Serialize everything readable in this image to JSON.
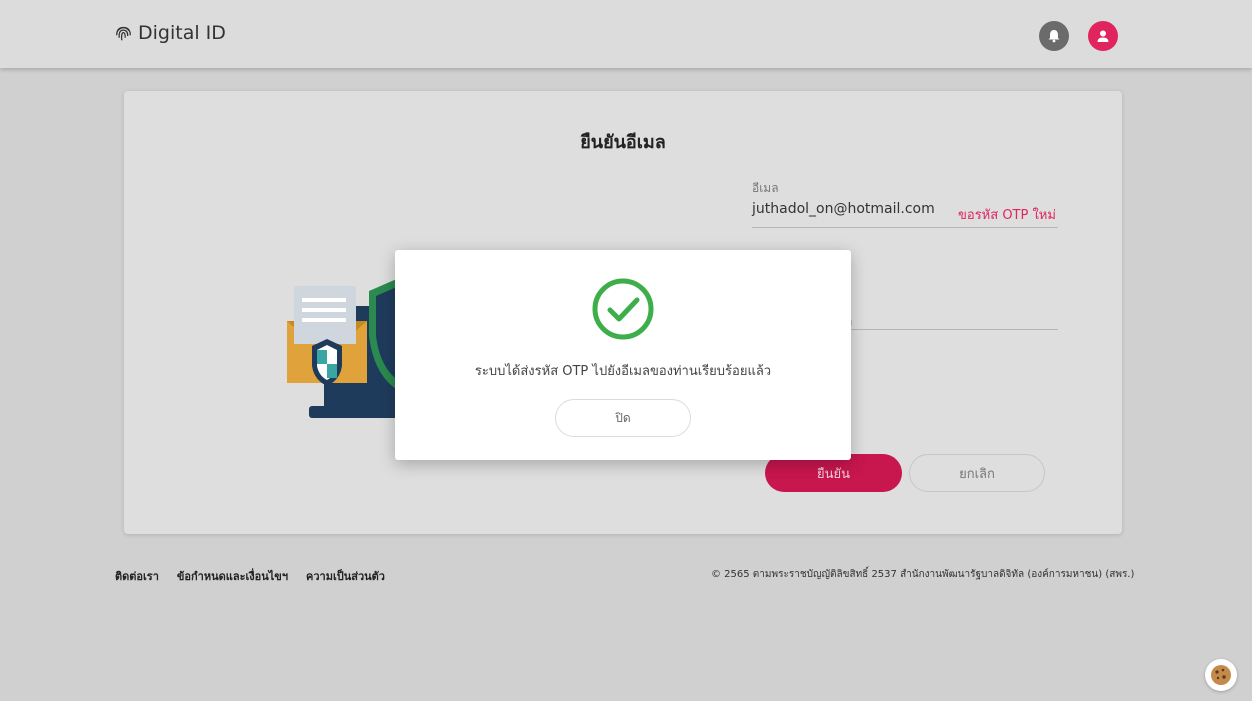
{
  "header": {
    "app_title": "Digital ID"
  },
  "verify": {
    "title": "ยืนยันอีเมล",
    "email_label": "อีเมล",
    "email_value": "juthadol_on@hotmail.com",
    "resend_label": "ขอรหัส OTP ใหม่",
    "otp_placeholder_fragment": "ล",
    "confirm_label": "ยืนยัน",
    "cancel_label": "ยกเลิก"
  },
  "modal": {
    "message": "ระบบได้ส่งรหัส OTP ไปยังอีเมลของท่านเรียบร้อยแล้ว",
    "close_label": "ปิด",
    "icon": "check-circle-icon"
  },
  "footer": {
    "links": [
      "ติดต่อเรา",
      "ข้อกำหนดและเงื่อนไขฯ",
      "ความเป็นส่วนตัว"
    ],
    "copyright": "© 2565 ตามพระราชบัญญัติลิขสิทธิ์ 2537 สำนักงานพัฒนารัฐบาลดิจิทัล (องค์การมหาชน) (สพร.)"
  },
  "colors": {
    "accent": "#e0245e",
    "success": "#3dae49"
  }
}
